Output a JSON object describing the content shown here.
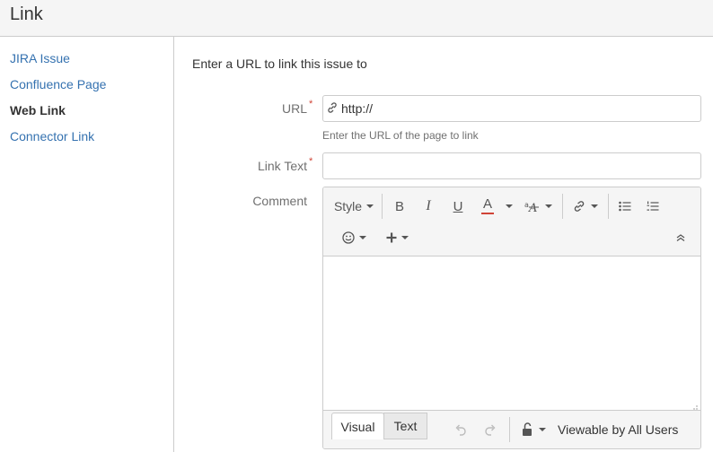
{
  "header": {
    "title": "Link"
  },
  "sidebar": {
    "items": [
      {
        "label": "JIRA Issue",
        "active": false
      },
      {
        "label": "Confluence Page",
        "active": false
      },
      {
        "label": "Web Link",
        "active": true
      },
      {
        "label": "Connector Link",
        "active": false
      }
    ]
  },
  "form": {
    "intro": "Enter a URL to link this issue to",
    "url": {
      "label": "URL",
      "required_mark": "*",
      "value": "http://",
      "help": "Enter the URL of the page to link"
    },
    "link_text": {
      "label": "Link Text",
      "required_mark": "*",
      "value": ""
    },
    "comment": {
      "label": "Comment"
    }
  },
  "editor": {
    "toolbar": {
      "style_label": "Style",
      "bold_label": "B",
      "italic_label": "I",
      "underline_label": "U",
      "color_label": "A",
      "text_color": "#d04437",
      "icons": [
        "text-effects-icon",
        "link-icon",
        "bullet-list-icon",
        "numbered-list-icon",
        "emoticon-icon",
        "insert-plus-icon",
        "collapse-toolbar-icon"
      ]
    },
    "footer": {
      "visual_tab": "Visual",
      "text_tab": "Text",
      "visibility_label": "Viewable by All Users"
    }
  },
  "colors": {
    "link": "#3572b0",
    "required": "#d04437",
    "border": "#cccccc"
  }
}
